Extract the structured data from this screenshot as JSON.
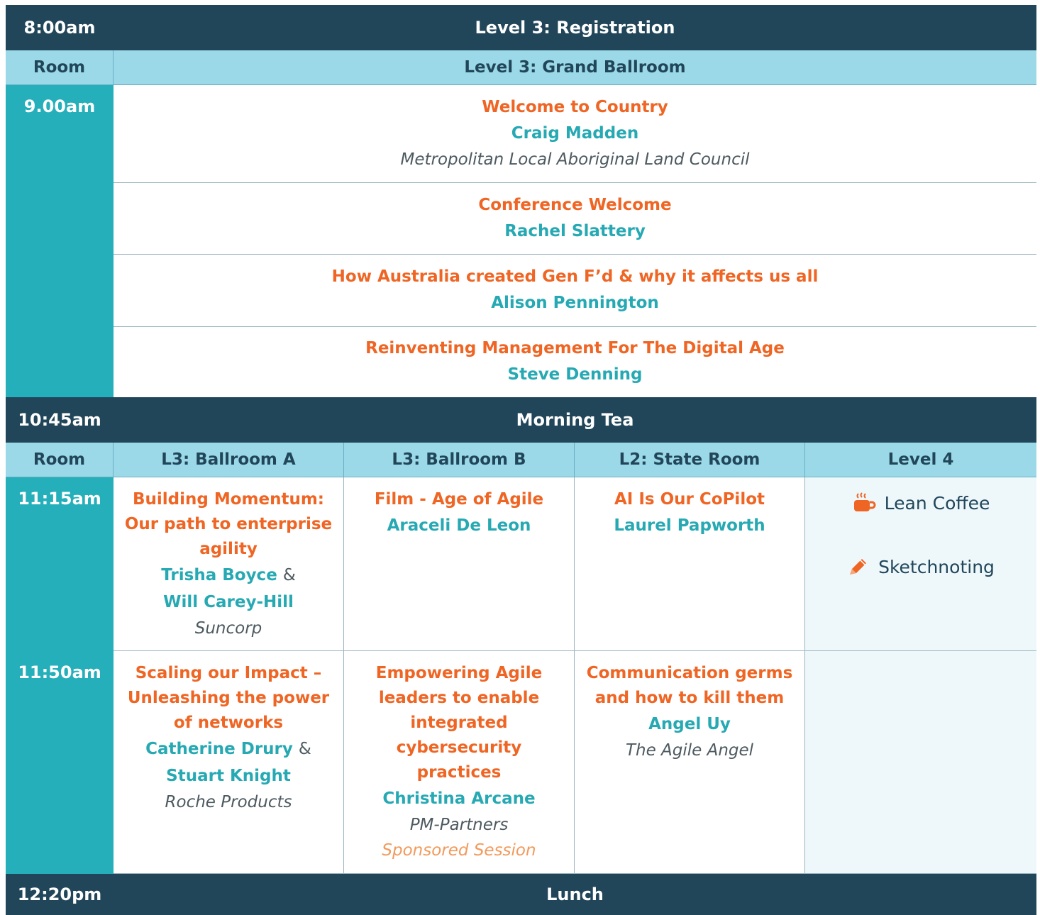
{
  "registration": {
    "time": "8:00am",
    "label": "Level 3: Registration"
  },
  "grand_header": {
    "room_label": "Room",
    "venue": "Level 3: Grand Ballroom"
  },
  "plenary": {
    "time": "9.00am",
    "sessions": [
      {
        "title": "Welcome to Country",
        "speaker": "Craig Madden",
        "org": "Metropolitan Local Aboriginal Land Council"
      },
      {
        "title": "Conference Welcome",
        "speaker": "Rachel Slattery"
      },
      {
        "title": "How Australia created Gen F’d & why it affects us all",
        "speaker": "Alison Pennington"
      },
      {
        "title": "Reinventing Management For The Digital Age",
        "speaker": "Steve Denning"
      }
    ]
  },
  "morning_tea": {
    "time": "10:45am",
    "label": "Morning Tea"
  },
  "rooms": {
    "room_label": "Room",
    "list": [
      "L3: Ballroom A",
      "L3: Ballroom B",
      "L2: State Room",
      "Level 4"
    ]
  },
  "slot1": {
    "time": "11:15am",
    "a": {
      "title": "Building Momentum: Our path to enterprise agility",
      "speaker1": "Trisha Boyce",
      "amp": "&",
      "speaker2": "Will Carey-Hill",
      "org": "Suncorp"
    },
    "b": {
      "title": "Film - Age of Agile",
      "speaker": "Araceli De Leon"
    },
    "c": {
      "title": "AI Is Our CoPilot",
      "speaker": "Laurel Papworth"
    },
    "d": {
      "item1": "Lean Coffee",
      "item1_icon": "coffee-icon",
      "item2": "Sketchnoting",
      "item2_icon": "pencil-icon"
    }
  },
  "slot2": {
    "time": "11:50am",
    "a": {
      "title": "Scaling our Impact – Unleashing the power of networks",
      "speaker1": "Catherine Drury",
      "amp": "&",
      "speaker2": "Stuart Knight",
      "org": "Roche Products"
    },
    "b": {
      "title": "Empowering Agile leaders to enable integrated cybersecurity practices",
      "speaker": "Christina Arcane",
      "org": "PM-Partners",
      "note": "Sponsored Session"
    },
    "c": {
      "title": "Communication germs and how to kill them",
      "speaker": "Angel Uy",
      "org": "The Agile Angel"
    }
  },
  "lunch": {
    "time": "12:20pm",
    "label": "Lunch"
  },
  "colors": {
    "dark": "#21465a",
    "teal": "#25afba",
    "light": "#9bd9e8",
    "orange": "#ef6524"
  }
}
